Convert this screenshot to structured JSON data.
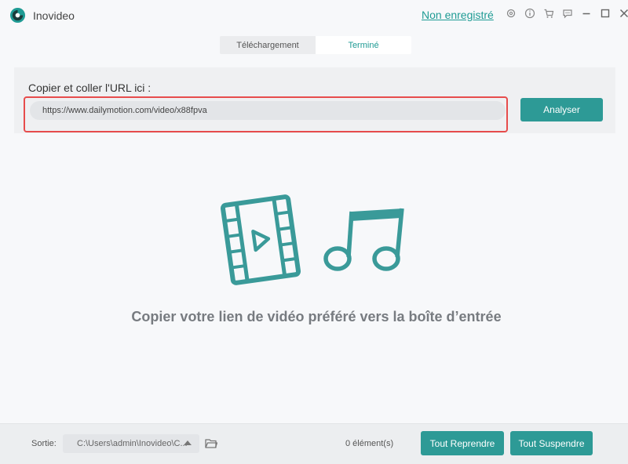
{
  "app": {
    "title": "Inovideo",
    "register_link": "Non enregistré"
  },
  "tabs": [
    {
      "label": "Téléchargement",
      "active": false
    },
    {
      "label": "Terminé",
      "active": true
    }
  ],
  "url_panel": {
    "label": "Copier et coller l'URL ici :",
    "value": "https://www.dailymotion.com/video/x88fpva",
    "analyze_label": "Analyser"
  },
  "main": {
    "hint": "Copier votre lien de vidéo préféré vers la boîte d’entrée"
  },
  "footer": {
    "output_label": "Sortie:",
    "output_path": "C:\\Users\\admin\\Inovideo\\C...",
    "count": "0 élément(s)",
    "resume_all": "Tout Reprendre",
    "pause_all": "Tout Suspendre"
  },
  "icons": [
    "app-logo-icon",
    "settings-icon",
    "info-icon",
    "cart-icon",
    "chat-icon",
    "minimize-icon",
    "maximize-icon",
    "close-icon",
    "film-icon",
    "music-note-icon",
    "folder-icon",
    "caret-up-icon"
  ],
  "colors": {
    "accent": "#2d9a96",
    "link": "#1f9b94",
    "highlight": "#e74c4c",
    "illustration": "#3a9a99"
  }
}
